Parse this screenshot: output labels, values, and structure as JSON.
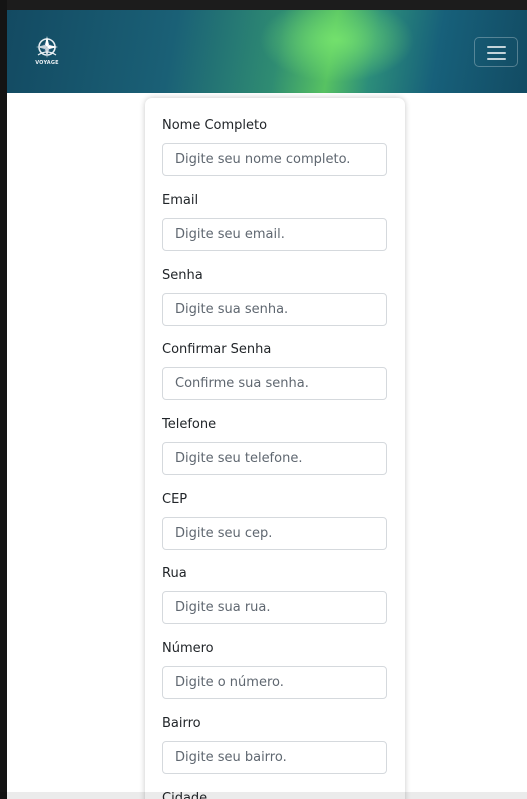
{
  "navbar": {
    "logo_text": "VOYAGE",
    "menu_icon": "hamburger-icon",
    "gradient_colors": [
      "#134a62",
      "#57c262",
      "#124b63"
    ]
  },
  "form": {
    "fields": [
      {
        "label": "Nome Completo",
        "placeholder": "Digite seu nome completo.",
        "value": ""
      },
      {
        "label": "Email",
        "placeholder": "Digite seu email.",
        "value": ""
      },
      {
        "label": "Senha",
        "placeholder": "Digite sua senha.",
        "value": ""
      },
      {
        "label": "Confirmar Senha",
        "placeholder": "Confirme sua senha.",
        "value": ""
      },
      {
        "label": "Telefone",
        "placeholder": "Digite seu telefone.",
        "value": ""
      },
      {
        "label": "CEP",
        "placeholder": "Digite seu cep.",
        "value": ""
      },
      {
        "label": "Rua",
        "placeholder": "Digite sua rua.",
        "value": ""
      },
      {
        "label": "Número",
        "placeholder": "Digite o número.",
        "value": ""
      },
      {
        "label": "Bairro",
        "placeholder": "Digite seu bairro.",
        "value": ""
      },
      {
        "label": "Cidade",
        "placeholder": "",
        "value": ""
      }
    ]
  }
}
